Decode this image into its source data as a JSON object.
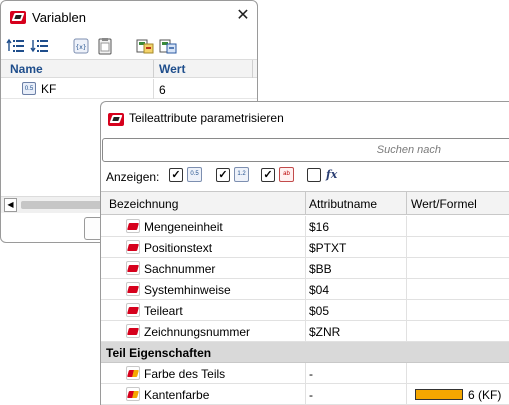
{
  "variablen_window": {
    "title": "Variablen",
    "close_glyph": "✕",
    "toolbar_icons": [
      "sort-ascending-icon",
      "sort-descending-icon",
      "variable-icon",
      "clipboard-icon",
      "import-variables-icon",
      "export-variables-icon"
    ],
    "columns": {
      "name": "Name",
      "wert": "Wert"
    },
    "rows": [
      {
        "icon": "variable-icon",
        "icon_text": "0.5",
        "name": "KF",
        "value": "6"
      }
    ]
  },
  "teileattribute_window": {
    "title": "Teileattribute parametrisieren",
    "search": {
      "placeholder": "Suchen nach",
      "value": ""
    },
    "filter": {
      "label": "Anzeigen:",
      "options": [
        {
          "icon": "numeric-attribute-icon",
          "icon_text": "0.5",
          "checked": true
        },
        {
          "icon": "integer-attribute-icon",
          "icon_text": "1.2",
          "checked": true
        },
        {
          "icon": "text-attribute-icon",
          "icon_text": "ab",
          "checked": true
        },
        {
          "icon": "formula-icon",
          "icon_text": "fx",
          "checked": false
        }
      ],
      "check_glyph": "✓"
    },
    "columns": {
      "bezeichnung": "Bezeichnung",
      "attributname": "Attributname",
      "wert_formel": "Wert/Formel"
    },
    "rows": [
      {
        "name": "Mengeneinheit",
        "attr": "$16",
        "value": ""
      },
      {
        "name": "Positionstext",
        "attr": "$PTXT",
        "value": ""
      },
      {
        "name": "Sachnummer",
        "attr": "$BB",
        "value": ""
      },
      {
        "name": "Systemhinweise",
        "attr": "$04",
        "value": ""
      },
      {
        "name": "Teileart",
        "attr": "$05",
        "value": ""
      },
      {
        "name": "Zeichnungsnummer",
        "attr": "$ZNR",
        "value": ""
      }
    ],
    "group": {
      "label": "Teil Eigenschaften"
    },
    "group_rows": [
      {
        "name": "Farbe des Teils",
        "attr": "-",
        "value": ""
      },
      {
        "name": "Kantenfarbe",
        "attr": "-",
        "value": "6 (KF)",
        "swatch_color": "#f5a700"
      }
    ]
  },
  "colors": {
    "brand_red": "#d6001c",
    "header_blue": "#1f4e8c",
    "group_background": "#d9d9d9",
    "swatch_orange": "#f5a700"
  }
}
